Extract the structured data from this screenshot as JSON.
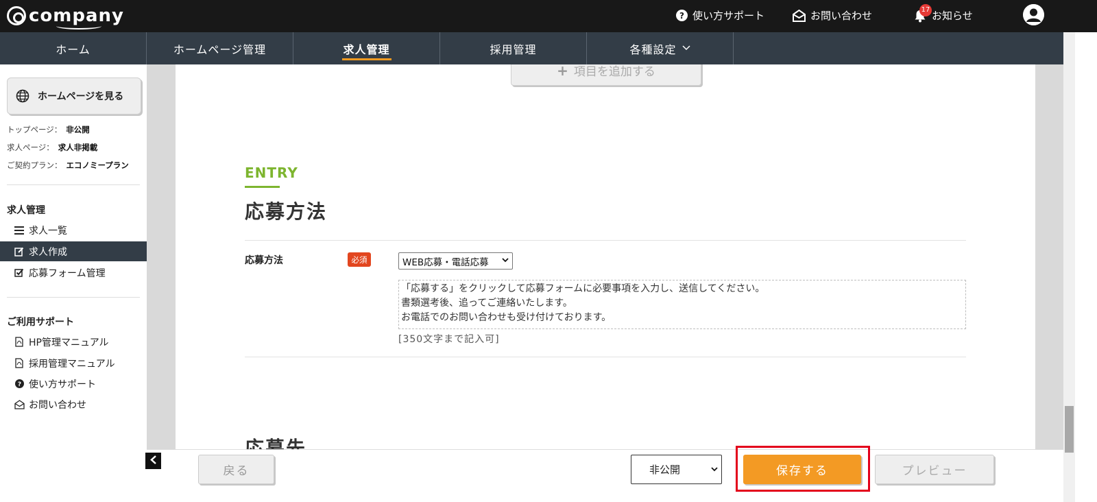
{
  "header": {
    "logo_text": "company",
    "support_label": "使い方サポート",
    "contact_label": "お問い合わせ",
    "notifications_label": "お知らせ",
    "notification_count": "17"
  },
  "nav": {
    "tabs": [
      {
        "label": "ホーム"
      },
      {
        "label": "ホームページ管理"
      },
      {
        "label": "求人管理"
      },
      {
        "label": "採用管理"
      },
      {
        "label": "各種設定"
      }
    ]
  },
  "sidebar": {
    "view_site_label": "ホームページを見る",
    "status": [
      {
        "label": "トップページ：",
        "value": "非公開"
      },
      {
        "label": "求人ページ：",
        "value": "求人非掲載"
      },
      {
        "label": "ご契約プラン：",
        "value": "エコノミープラン"
      }
    ],
    "section1_heading": "求人管理",
    "section1_items": [
      {
        "label": "求人一覧"
      },
      {
        "label": "求人作成"
      },
      {
        "label": "応募フォーム管理"
      }
    ],
    "section2_heading": "ご利用サポート",
    "section2_items": [
      {
        "label": "HP管理マニュアル"
      },
      {
        "label": "採用管理マニュアル"
      },
      {
        "label": "使い方サポート"
      },
      {
        "label": "お問い合わせ"
      }
    ]
  },
  "main": {
    "add_item_label": "項目を追加する",
    "entry_label": "ENTRY",
    "section_title": "応募方法",
    "field_label": "応募方法",
    "required_label": "必須",
    "method_value": "WEB応募・電話応募",
    "method_text": "「応募する」をクリックして応募フォームに必要事項を入力し、送信してください。\n書類選考後、追ってご連絡いたします。\nお電話でのお問い合わせも受け付けております。",
    "char_limit_note": "[350文字まで記入可]",
    "next_section_title": "応募先"
  },
  "footer": {
    "back_label": "戻る",
    "visibility_value": "非公開",
    "save_label": "保存する",
    "preview_label": "プレビュー"
  },
  "colors": {
    "accent_orange": "#f39a24",
    "entry_green": "#7db52f",
    "required_red": "#e2461f",
    "nav_bg": "#333d47",
    "highlight_red": "#e3001b"
  }
}
